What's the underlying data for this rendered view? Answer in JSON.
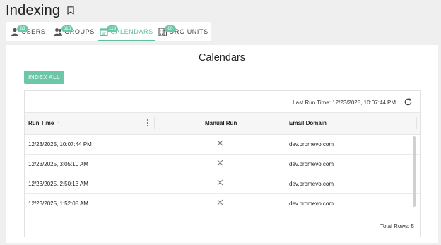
{
  "header": {
    "title": "Indexing"
  },
  "tabs": [
    {
      "label": "USERS",
      "badge": "83",
      "icon": "user-icon"
    },
    {
      "label": "GROUPS",
      "badge": "616",
      "icon": "group-icon"
    },
    {
      "label": "CALENDARS",
      "badge": "118",
      "icon": "calendar-icon",
      "active": true
    },
    {
      "label": "ORG UNITS",
      "badge": "60",
      "icon": "building-icon"
    }
  ],
  "main": {
    "title": "Calendars",
    "index_all_label": "INDEX ALL",
    "last_run": "Last Run Time: 12/23/2025, 10:07:44 PM",
    "columns": {
      "run_time": "Run Time",
      "manual_run": "Manual Run",
      "email_domain": "Email Domain"
    },
    "rows": [
      {
        "run_time": "12/23/2025, 10:07:44 PM",
        "manual_run": "x-icon",
        "email_domain": "dev.promevo.com"
      },
      {
        "run_time": "12/23/2025, 3:05:10 AM",
        "manual_run": "x-icon",
        "email_domain": "dev.promevo.com"
      },
      {
        "run_time": "12/23/2025, 2:50:13 AM",
        "manual_run": "x-icon",
        "email_domain": "dev.promevo.com"
      },
      {
        "run_time": "12/23/2025, 1:52:08 AM",
        "manual_run": "x-icon",
        "email_domain": "dev.promevo.com"
      }
    ],
    "total_rows": "Total Rows: 5"
  },
  "colors": {
    "accent": "#6cc7a8",
    "active_tab": "#5fbf9e",
    "background": "#efefef"
  }
}
